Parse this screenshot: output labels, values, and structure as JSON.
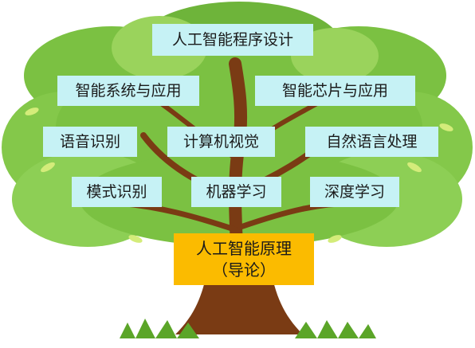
{
  "top": "人工智能程序设计",
  "row1": [
    "智能系统与应用",
    "智能芯片与应用"
  ],
  "row2": [
    "语音识别",
    "计算机视觉",
    "自然语言处理"
  ],
  "row3": [
    "模式识别",
    "机器学习",
    "深度学习"
  ],
  "root": {
    "line1": "人工智能原理",
    "line2": "（导论）"
  },
  "colors": {
    "label_bg": "#c6f2f5",
    "root_bg": "#fbbb00",
    "foliage": "#7bc142",
    "trunk": "#7a3b14",
    "grass": "#5ba528"
  }
}
